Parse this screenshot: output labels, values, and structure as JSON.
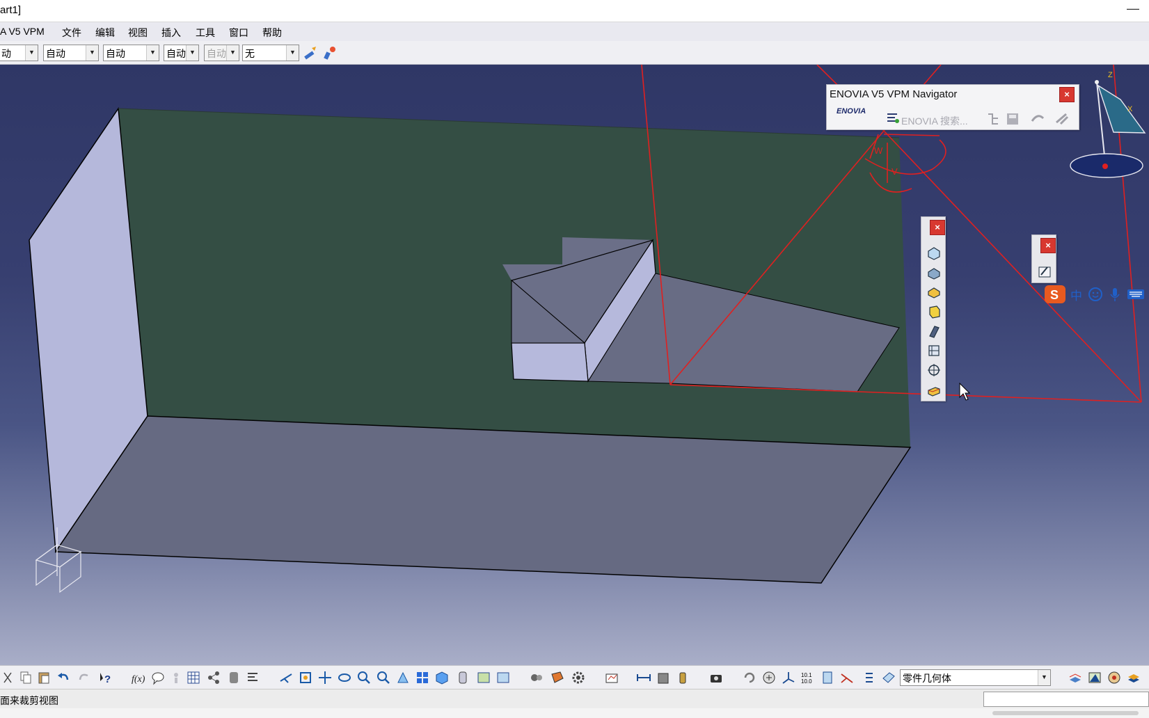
{
  "window": {
    "title": "art1]",
    "minimize_glyph": "—"
  },
  "menu": {
    "items": [
      "A V5 VPM",
      "文件",
      "编辑",
      "视图",
      "插入",
      "工具",
      "窗口",
      "帮助"
    ]
  },
  "toolbar": {
    "combos": [
      {
        "value": "动"
      },
      {
        "value": "自动"
      },
      {
        "value": "自动"
      },
      {
        "value": "自动"
      },
      {
        "value": "自动"
      },
      {
        "value": "无"
      }
    ],
    "icons": [
      "paint-brush-icon",
      "painter-icon"
    ]
  },
  "navigator": {
    "title": "ENOVIA V5 VPM Navigator",
    "search_label": "ENOVIA 搜索...",
    "logo_text": "ENOVIA",
    "close": "×"
  },
  "vertical_toolbar": {
    "close": "×",
    "tools": [
      "pad-icon",
      "drafted-pad-icon",
      "multi-pad-icon",
      "solid-icon",
      "rib-icon",
      "stiffener-icon",
      "positioning-icon",
      "loft-icon"
    ]
  },
  "small_toolbar": {
    "close": "×",
    "tools": [
      "sketch-icon"
    ]
  },
  "ime": {
    "mode": "中",
    "items": [
      "sogou-logo-icon",
      "smiley-icon",
      "microphone-icon",
      "keyboard-icon"
    ]
  },
  "compass": {
    "z_label": "Z",
    "x_label": "X"
  },
  "axis_labels": {
    "w": "W",
    "v": "V"
  },
  "bottom_toolbar": {
    "geometry_select": "零件几何体",
    "icons": [
      "cut-icon",
      "copy-icon",
      "paste-icon",
      "undo-icon",
      "redo-icon",
      "whatsthis-icon",
      "formula-icon",
      "comment-icon",
      "knowledge-icon",
      "table-icon",
      "tree-icon",
      "measure-icon",
      "publication-icon",
      "fly-icon",
      "fit-all-icon",
      "pan-icon",
      "rotate-icon",
      "zoom-in-icon",
      "zoom-out-icon",
      "normal-view-icon",
      "multi-view-icon",
      "iso-view-icon",
      "shading-icon",
      "hide-show-icon",
      "swap-icon",
      "catalog-icon",
      "gear-icon",
      "settings-icon",
      "analysis-icon",
      "measure-between-icon",
      "measure-item-icon",
      "inertia-icon",
      "camera-icon",
      "update-icon",
      "hand-icon",
      "axis-system-icon",
      "grid-icon",
      "constraint-icon",
      "dimension-icon",
      "list-icon",
      "material-icon",
      "layers-icon",
      "render-icon",
      "map-icon",
      "globe-icon"
    ]
  },
  "status": {
    "text": "面来裁剪视图"
  }
}
